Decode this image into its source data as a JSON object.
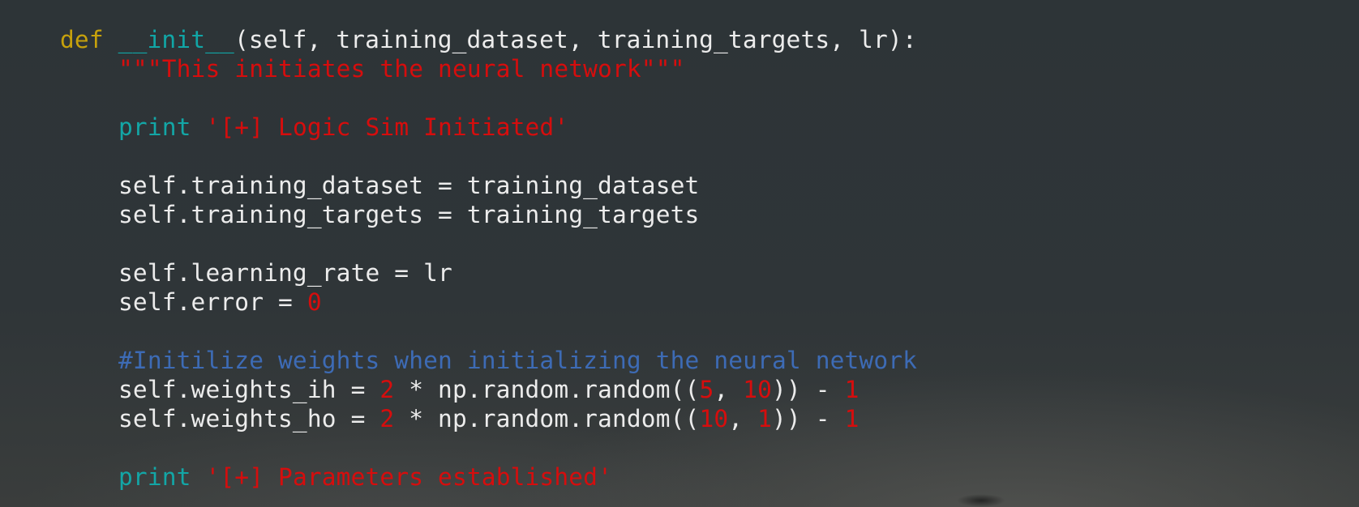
{
  "code_lines": [
    {
      "indent": 0,
      "tokens": [
        {
          "t": "def",
          "c": "kw"
        },
        {
          "t": " ",
          "c": "txt"
        },
        {
          "t": "__init__",
          "c": "fn"
        },
        {
          "t": "(self, training_dataset, training_targets, lr):",
          "c": "txt"
        }
      ]
    },
    {
      "indent": 1,
      "tokens": [
        {
          "t": "\"\"\"This initiates the neural network\"\"\"",
          "c": "str"
        }
      ]
    },
    {
      "indent": 0,
      "tokens": []
    },
    {
      "indent": 1,
      "tokens": [
        {
          "t": "print",
          "c": "bi"
        },
        {
          "t": " ",
          "c": "txt"
        },
        {
          "t": "'[+] Logic Sim Initiated'",
          "c": "str"
        }
      ]
    },
    {
      "indent": 0,
      "tokens": []
    },
    {
      "indent": 1,
      "tokens": [
        {
          "t": "self.training_dataset = training_dataset",
          "c": "txt"
        }
      ]
    },
    {
      "indent": 1,
      "tokens": [
        {
          "t": "self.training_targets = training_targets",
          "c": "txt"
        }
      ]
    },
    {
      "indent": 0,
      "tokens": []
    },
    {
      "indent": 1,
      "tokens": [
        {
          "t": "self.learning_rate = lr",
          "c": "txt"
        }
      ]
    },
    {
      "indent": 1,
      "tokens": [
        {
          "t": "self.error = ",
          "c": "txt"
        },
        {
          "t": "0",
          "c": "num"
        }
      ]
    },
    {
      "indent": 0,
      "tokens": []
    },
    {
      "indent": 1,
      "tokens": [
        {
          "t": "#Initilize weights when initializing the neural network",
          "c": "com"
        }
      ]
    },
    {
      "indent": 1,
      "tokens": [
        {
          "t": "self.weights_ih = ",
          "c": "txt"
        },
        {
          "t": "2",
          "c": "num"
        },
        {
          "t": " * np.random.random((",
          "c": "txt"
        },
        {
          "t": "5",
          "c": "num"
        },
        {
          "t": ", ",
          "c": "txt"
        },
        {
          "t": "10",
          "c": "num"
        },
        {
          "t": ")) - ",
          "c": "txt"
        },
        {
          "t": "1",
          "c": "num"
        }
      ]
    },
    {
      "indent": 1,
      "tokens": [
        {
          "t": "self.weights_ho = ",
          "c": "txt"
        },
        {
          "t": "2",
          "c": "num"
        },
        {
          "t": " * np.random.random((",
          "c": "txt"
        },
        {
          "t": "10",
          "c": "num"
        },
        {
          "t": ", ",
          "c": "txt"
        },
        {
          "t": "1",
          "c": "num"
        },
        {
          "t": ")) - ",
          "c": "txt"
        },
        {
          "t": "1",
          "c": "num"
        }
      ]
    },
    {
      "indent": 0,
      "tokens": []
    },
    {
      "indent": 1,
      "tokens": [
        {
          "t": "print",
          "c": "bi"
        },
        {
          "t": " ",
          "c": "txt"
        },
        {
          "t": "'[+] Parameters established'",
          "c": "str"
        }
      ]
    }
  ],
  "colors": {
    "keyword": "#c6a10c",
    "function_name": "#11a6a6",
    "builtin": "#13a6a6",
    "string": "#d60d0d",
    "number": "#d60d0d",
    "comment": "#3d6bb5",
    "text": "#ececec",
    "background": "#2f3538"
  }
}
